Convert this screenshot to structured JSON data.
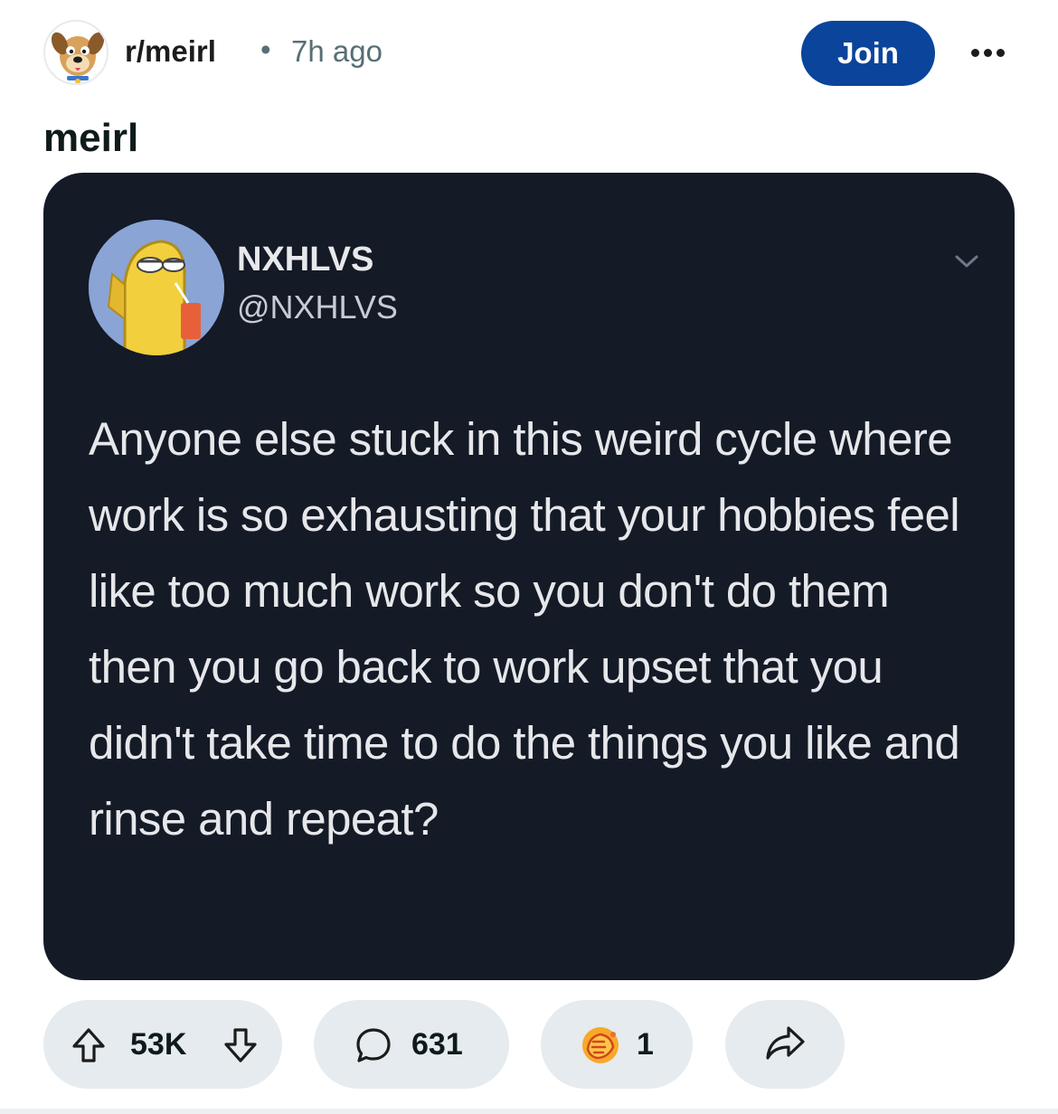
{
  "post": {
    "subreddit": "r/meirl",
    "separator": "•",
    "time": "7h ago",
    "join_label": "Join",
    "title": "meirl"
  },
  "tweet": {
    "name": "NXHLVS",
    "handle": "@NXHLVS",
    "text": "Anyone else stuck in this weird cycle where work is so exhausting that your hobbies feel like too much work so you don't do them then you go back to work upset that you didn't take time to do the things you like and rinse and repeat?"
  },
  "actions": {
    "votes": "53K",
    "comments": "631",
    "awards": "1"
  },
  "colors": {
    "join_button": "#0a449b",
    "pill_background": "#e5ebee",
    "image_background": "#141a26"
  },
  "icons": [
    "subreddit-avatar-icon",
    "more-options-icon",
    "chevron-down-icon",
    "upvote-icon",
    "downvote-icon",
    "comment-icon",
    "award-icon",
    "share-icon"
  ]
}
